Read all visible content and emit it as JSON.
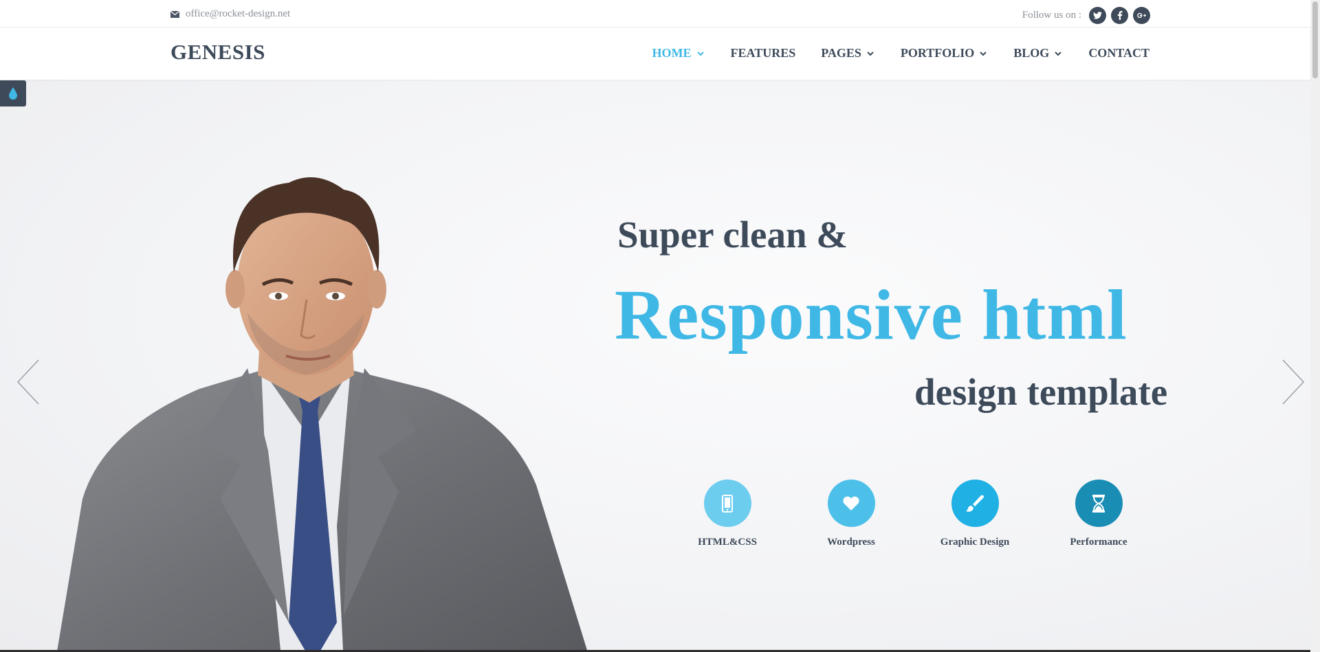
{
  "topbar": {
    "email": "office@rocket-design.net",
    "follow_label": "Follow us on :",
    "social": [
      {
        "icon": "twitter-icon",
        "glyph": "t"
      },
      {
        "icon": "facebook-icon",
        "glyph": "f"
      },
      {
        "icon": "google-plus-icon",
        "glyph": "g+"
      }
    ]
  },
  "nav": {
    "logo": "GENESIS",
    "items": [
      {
        "label": "HOME",
        "active": true,
        "dropdown": true
      },
      {
        "label": "FEATURES",
        "active": false,
        "dropdown": false
      },
      {
        "label": "PAGES",
        "active": false,
        "dropdown": true
      },
      {
        "label": "PORTFOLIO",
        "active": false,
        "dropdown": true
      },
      {
        "label": "BLOG",
        "active": false,
        "dropdown": true
      },
      {
        "label": "CONTACT",
        "active": false,
        "dropdown": false
      }
    ]
  },
  "hero": {
    "line1": "Super clean &",
    "line2": "Responsive html",
    "line3": "design template",
    "features": [
      {
        "label": "HTML&CSS",
        "icon": "mobile-icon",
        "color": "#6ccdef"
      },
      {
        "label": "Wordpress",
        "icon": "heart-icon",
        "color": "#4dc0ea"
      },
      {
        "label": "Graphic Design",
        "icon": "brush-icon",
        "color": "#1fb0e4"
      },
      {
        "label": "Performance",
        "icon": "hourglass-icon",
        "color": "#1a8db5"
      }
    ]
  },
  "colors": {
    "accent": "#3fb8e6",
    "dark": "#3d4a5a",
    "muted": "#8a8f96"
  }
}
